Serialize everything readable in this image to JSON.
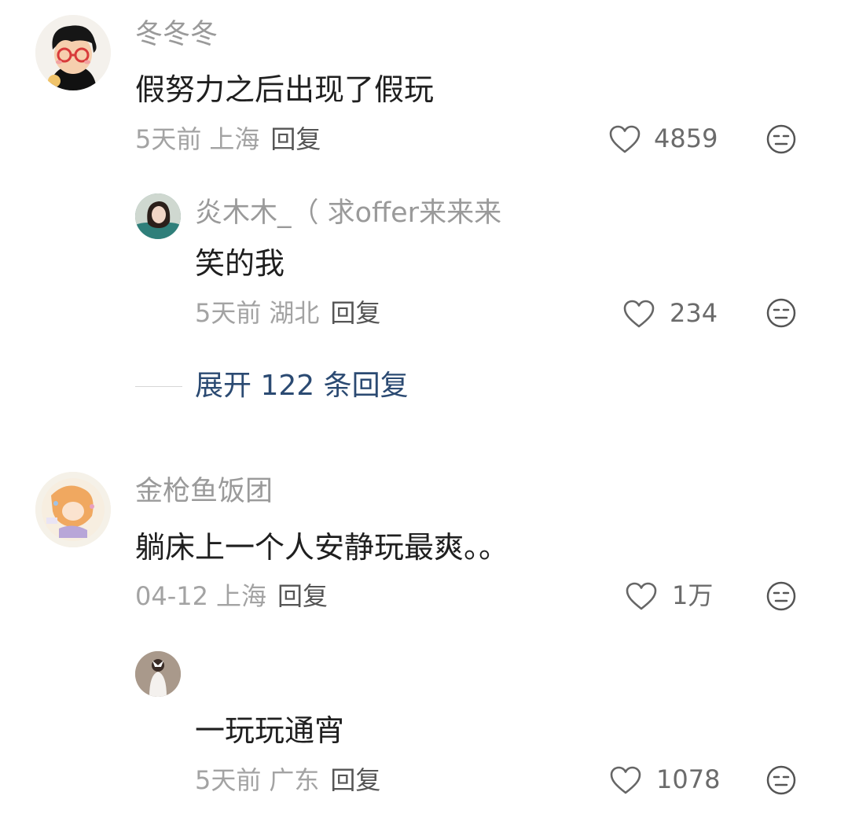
{
  "comments": [
    {
      "username": "冬冬冬",
      "text": "假努力之后出现了假玩",
      "time": "5天前",
      "location": "上海",
      "reply_label": "回复",
      "likes": "4859",
      "avatar_icon": "cartoon-boy-with-glasses-avatar",
      "replies": [
        {
          "username": "炎木木_（ 求offer来来来",
          "text": "笑的我",
          "time": "5天前",
          "location": "湖北",
          "reply_label": "回复",
          "likes": "234",
          "avatar_icon": "girl-photo-avatar"
        }
      ],
      "expand_label": "展开 122 条回复"
    },
    {
      "username": "金枪鱼饭团",
      "text": "躺床上一个人安静玩最爽。。",
      "time": "04-12",
      "location": "上海",
      "reply_label": "回复",
      "likes": "1万",
      "avatar_icon": "anime-illustration-avatar",
      "replies": [
        {
          "username": "",
          "text": "一玩玩通宵",
          "time": "5天前",
          "location": "广东",
          "reply_label": "回复",
          "likes": "1078",
          "avatar_icon": "white-dress-photo-avatar"
        }
      ]
    }
  ],
  "colors": {
    "username": "#9a9a9a",
    "content": "#1f1f1f",
    "meta": "#a3a3a3",
    "reply": "#555555",
    "expand": "#2b4a72"
  },
  "icons": {
    "like": "heart-outline-icon",
    "dislike": "meh-face-icon"
  }
}
